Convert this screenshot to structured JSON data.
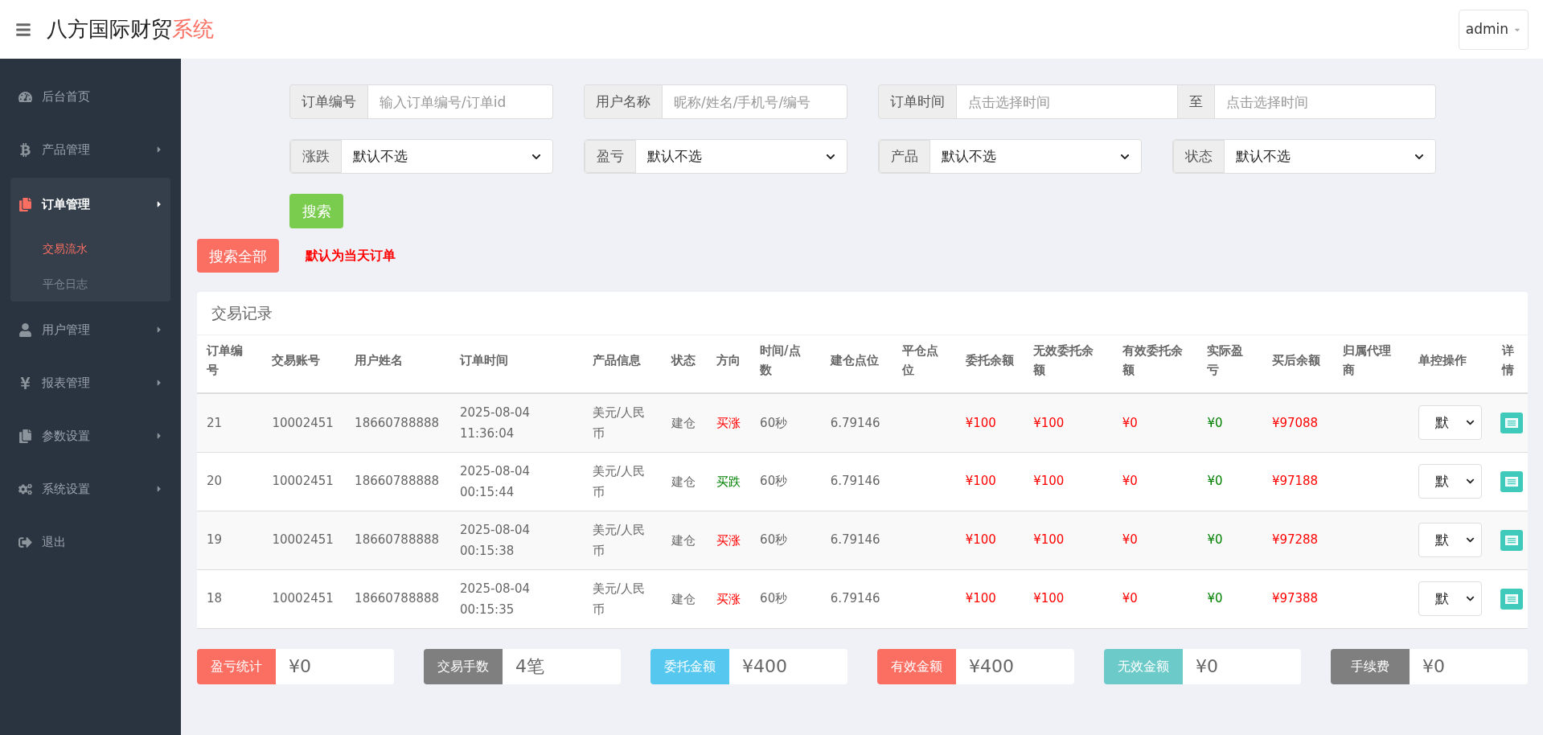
{
  "header": {
    "title": "八方国际财贸",
    "title_accent": "系统",
    "user_menu": "admin"
  },
  "sidebar": {
    "items": [
      {
        "label": "后台首页",
        "has_arrow": false,
        "selected": false
      },
      {
        "label": "产品管理",
        "has_arrow": true,
        "selected": false
      },
      {
        "label": "订单管理",
        "has_arrow": true,
        "selected": true,
        "children": [
          {
            "label": "交易流水",
            "selected": true
          },
          {
            "label": "平仓日志",
            "selected": false
          }
        ]
      },
      {
        "label": "用户管理",
        "has_arrow": true,
        "selected": false
      },
      {
        "label": "报表管理",
        "has_arrow": true,
        "selected": false
      },
      {
        "label": "参数设置",
        "has_arrow": true,
        "selected": false
      },
      {
        "label": "系统设置",
        "has_arrow": true,
        "selected": false
      },
      {
        "label": "退出",
        "has_arrow": false,
        "selected": false
      }
    ]
  },
  "filters": {
    "row_1": [
      {
        "kind": "input",
        "label": "订单编号",
        "placeholder": "输入订单编号/订单id"
      },
      {
        "kind": "input",
        "label": "用户名称",
        "placeholder": "昵称/姓名/手机号/编号"
      },
      {
        "kind": "range",
        "label": "订单时间",
        "placeholder": "点击选择时间",
        "separator": "至",
        "placeholder_2": "点击选择时间"
      }
    ],
    "row_2": [
      {
        "kind": "select",
        "label": "涨跌",
        "value": "默认不选"
      },
      {
        "kind": "select",
        "label": "盈亏",
        "value": "默认不选"
      },
      {
        "kind": "select",
        "label": "产品",
        "value": "默认不选"
      },
      {
        "kind": "select",
        "label": "状态",
        "value": "默认不选"
      }
    ],
    "search_button": "搜索",
    "search_all_button": "搜索全部",
    "note": "默认为当天订单"
  },
  "table": {
    "title": "交易记录",
    "columns": [
      "订单编号",
      "交易账号",
      "用户姓名",
      "订单时间",
      "产品信息",
      "状态",
      "方向",
      "时间/点数",
      "建仓点位",
      "平仓点位",
      "委托余额",
      "无效委托余额",
      "有效委托余额",
      "实际盈亏",
      "买后余额",
      "归属代理商",
      "单控操作",
      "详情"
    ],
    "rows": [
      {
        "id": "21",
        "account": "10002451",
        "user": "18660788888",
        "time": "2025-08-04 11:36:04",
        "product": "美元/人民币",
        "status": "建仓",
        "direction": {
          "text": "买涨",
          "kind": "up"
        },
        "duration": "60秒",
        "open_price": "6.79146",
        "entrust": "¥100",
        "invalid": "¥100",
        "valid": "¥0",
        "profit": "¥0",
        "balance": "¥97088",
        "control": "默"
      },
      {
        "id": "20",
        "account": "10002451",
        "user": "18660788888",
        "time": "2025-08-04 00:15:44",
        "product": "美元/人民币",
        "status": "建仓",
        "direction": {
          "text": "买跌",
          "kind": "down"
        },
        "duration": "60秒",
        "open_price": "6.79146",
        "entrust": "¥100",
        "invalid": "¥100",
        "valid": "¥0",
        "profit": "¥0",
        "balance": "¥97188",
        "control": "默"
      },
      {
        "id": "19",
        "account": "10002451",
        "user": "18660788888",
        "time": "2025-08-04 00:15:38",
        "product": "美元/人民币",
        "status": "建仓",
        "direction": {
          "text": "买涨",
          "kind": "up"
        },
        "duration": "60秒",
        "open_price": "6.79146",
        "entrust": "¥100",
        "invalid": "¥100",
        "valid": "¥0",
        "profit": "¥0",
        "balance": "¥97288",
        "control": "默"
      },
      {
        "id": "18",
        "account": "10002451",
        "user": "18660788888",
        "time": "2025-08-04 00:15:35",
        "product": "美元/人民币",
        "status": "建仓",
        "direction": {
          "text": "买涨",
          "kind": "up"
        },
        "duration": "60秒",
        "open_price": "6.79146",
        "entrust": "¥100",
        "invalid": "¥100",
        "valid": "¥0",
        "profit": "¥0",
        "balance": "¥97388",
        "control": "默"
      }
    ]
  },
  "stats": [
    {
      "label": "盈亏统计",
      "value": "¥0",
      "color": "#fb6e62"
    },
    {
      "label": "交易手数",
      "value": "4笔",
      "color": "#7f7f7f"
    },
    {
      "label": "委托金额",
      "value": "¥400",
      "color": "#56c8f0"
    },
    {
      "label": "有效金额",
      "value": "¥400",
      "color": "#fb6e62"
    },
    {
      "label": "无效金额",
      "value": "¥0",
      "color": "#6ccac9"
    },
    {
      "label": "手续费",
      "value": "¥0",
      "color": "#7f7f7f"
    }
  ]
}
